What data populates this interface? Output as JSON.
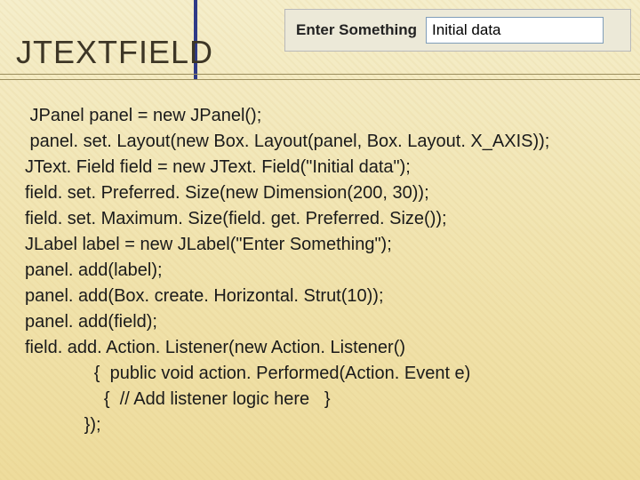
{
  "title": "JTEXTFIELD",
  "swing": {
    "label": "Enter Something",
    "value": "Initial data"
  },
  "code": {
    "line1": " JPanel panel = new JPanel();",
    "line2": " panel. set. Layout(new Box. Layout(panel, Box. Layout. X_AXIS));",
    "line3": "JText. Field field = new JText. Field(\"Initial data\");",
    "line4": "field. set. Preferred. Size(new Dimension(200, 30));",
    "line5": "field. set. Maximum. Size(field. get. Preferred. Size());",
    "line6": "JLabel label = new JLabel(\"Enter Something\");",
    "line7": "panel. add(label);",
    "line8": "panel. add(Box. create. Horizontal. Strut(10));",
    "line9": "panel. add(field);",
    "line10": "field. add. Action. Listener(new Action. Listener()",
    "line11": "              {  public void action. Performed(Action. Event e)",
    "line12": "                {  // Add listener logic here   }",
    "line13": "            });"
  }
}
